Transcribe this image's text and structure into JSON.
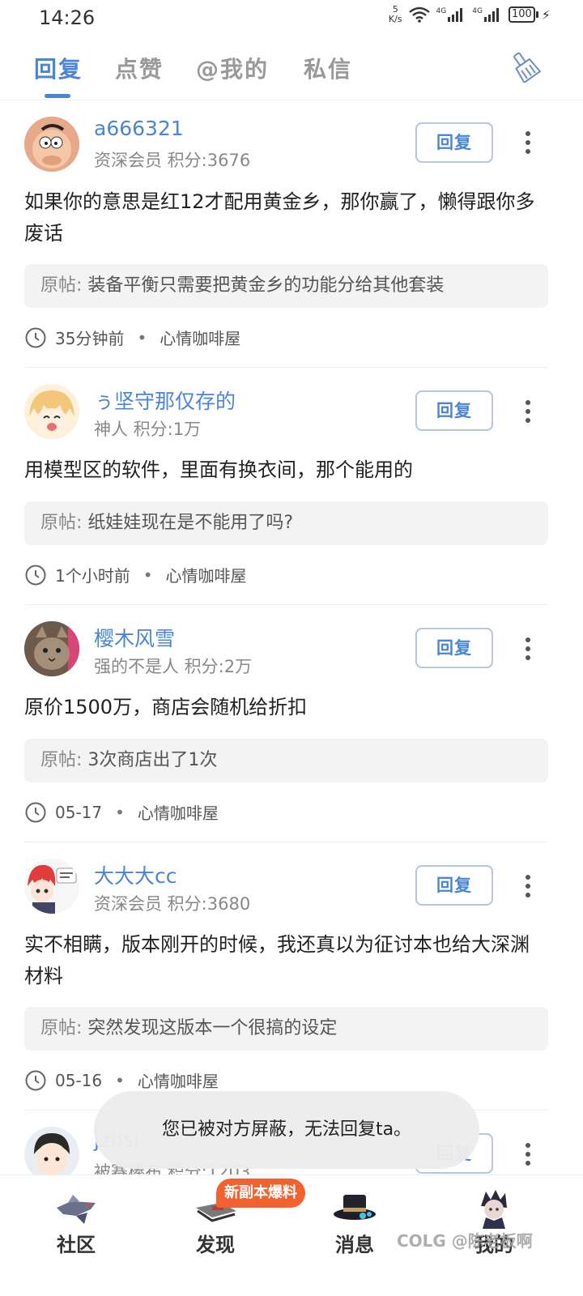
{
  "status_bar": {
    "time": "14:26",
    "net_speed_value": "5",
    "net_speed_unit": "K/s",
    "network_1": "4G",
    "network_2": "4G",
    "battery": "100"
  },
  "tabs": [
    {
      "label": "回复",
      "active": true
    },
    {
      "label": "点赞",
      "active": false
    },
    {
      "label": "@我的",
      "active": false
    },
    {
      "label": "私信",
      "active": false
    }
  ],
  "clear_icon": "broom-icon",
  "reply_label": "回复",
  "quote_label": "原帖:",
  "posts": [
    {
      "username": "a666321",
      "meta": "资深会员 积分:3676",
      "content": "如果你的意思是红12才配用黄金乡，那你赢了，懒得跟你多废话",
      "quote": "装备平衡只需要把黄金乡的功能分给其他套装",
      "time": "35分钟前",
      "board": "心情咖啡屋"
    },
    {
      "username": "ぅ坚守那仅存的",
      "meta": "神人 积分:1万",
      "content": "用模型区的软件，里面有换衣间，那个能用的",
      "quote": "纸娃娃现在是不能用了吗?",
      "time": "1个小时前",
      "board": "心情咖啡屋"
    },
    {
      "username": "樱木风雪",
      "meta": "强的不是人 积分:2万",
      "content": "原价1500万，商店会随机给折扣",
      "quote": "3次商店出了1次",
      "time": "05-17",
      "board": "心情咖啡屋"
    },
    {
      "username": "大大大cc",
      "meta": "资深会员 积分:3680",
      "content": "实不相瞒，版本刚开的时候，我还真以为征讨本也给大深渊材料",
      "quote": "突然发现这版本一个很搞的设定",
      "time": "05-16",
      "board": "心情咖啡屋"
    },
    {
      "username": "jzbsj",
      "meta": "被赛棒布 积分:1203"
    }
  ],
  "toast": "您已被对方屏蔽，无法回复ta。",
  "bottom_nav": [
    {
      "label": "社区",
      "icon": "community-icon",
      "active": false
    },
    {
      "label": "发现",
      "icon": "discover-icon",
      "active": false
    },
    {
      "label": "消息",
      "icon": "messages-icon",
      "active": true
    },
    {
      "label": "我的",
      "icon": "profile-icon",
      "active": false
    }
  ],
  "nav_badge": "新副本爆料",
  "watermark": "COLG @陈老板啊",
  "colors": {
    "accent": "#4a86d4",
    "nav_active": "#f08a24",
    "badge": "#f2622f"
  }
}
